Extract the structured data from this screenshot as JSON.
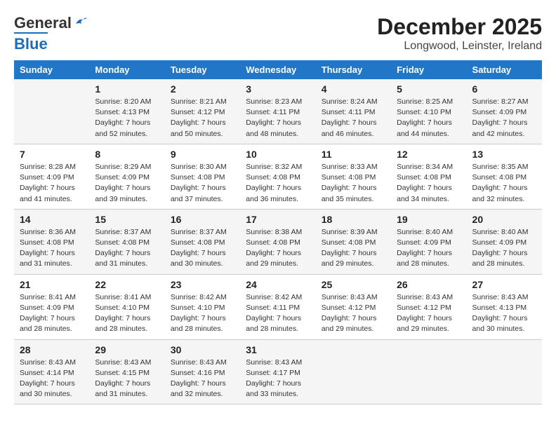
{
  "header": {
    "logo_general": "General",
    "logo_blue": "Blue",
    "title": "December 2025",
    "subtitle": "Longwood, Leinster, Ireland"
  },
  "days_of_week": [
    "Sunday",
    "Monday",
    "Tuesday",
    "Wednesday",
    "Thursday",
    "Friday",
    "Saturday"
  ],
  "weeks": [
    [
      {
        "day": "",
        "info": ""
      },
      {
        "day": "1",
        "info": "Sunrise: 8:20 AM\nSunset: 4:13 PM\nDaylight: 7 hours\nand 52 minutes."
      },
      {
        "day": "2",
        "info": "Sunrise: 8:21 AM\nSunset: 4:12 PM\nDaylight: 7 hours\nand 50 minutes."
      },
      {
        "day": "3",
        "info": "Sunrise: 8:23 AM\nSunset: 4:11 PM\nDaylight: 7 hours\nand 48 minutes."
      },
      {
        "day": "4",
        "info": "Sunrise: 8:24 AM\nSunset: 4:11 PM\nDaylight: 7 hours\nand 46 minutes."
      },
      {
        "day": "5",
        "info": "Sunrise: 8:25 AM\nSunset: 4:10 PM\nDaylight: 7 hours\nand 44 minutes."
      },
      {
        "day": "6",
        "info": "Sunrise: 8:27 AM\nSunset: 4:09 PM\nDaylight: 7 hours\nand 42 minutes."
      }
    ],
    [
      {
        "day": "7",
        "info": "Sunrise: 8:28 AM\nSunset: 4:09 PM\nDaylight: 7 hours\nand 41 minutes."
      },
      {
        "day": "8",
        "info": "Sunrise: 8:29 AM\nSunset: 4:09 PM\nDaylight: 7 hours\nand 39 minutes."
      },
      {
        "day": "9",
        "info": "Sunrise: 8:30 AM\nSunset: 4:08 PM\nDaylight: 7 hours\nand 37 minutes."
      },
      {
        "day": "10",
        "info": "Sunrise: 8:32 AM\nSunset: 4:08 PM\nDaylight: 7 hours\nand 36 minutes."
      },
      {
        "day": "11",
        "info": "Sunrise: 8:33 AM\nSunset: 4:08 PM\nDaylight: 7 hours\nand 35 minutes."
      },
      {
        "day": "12",
        "info": "Sunrise: 8:34 AM\nSunset: 4:08 PM\nDaylight: 7 hours\nand 34 minutes."
      },
      {
        "day": "13",
        "info": "Sunrise: 8:35 AM\nSunset: 4:08 PM\nDaylight: 7 hours\nand 32 minutes."
      }
    ],
    [
      {
        "day": "14",
        "info": "Sunrise: 8:36 AM\nSunset: 4:08 PM\nDaylight: 7 hours\nand 31 minutes."
      },
      {
        "day": "15",
        "info": "Sunrise: 8:37 AM\nSunset: 4:08 PM\nDaylight: 7 hours\nand 31 minutes."
      },
      {
        "day": "16",
        "info": "Sunrise: 8:37 AM\nSunset: 4:08 PM\nDaylight: 7 hours\nand 30 minutes."
      },
      {
        "day": "17",
        "info": "Sunrise: 8:38 AM\nSunset: 4:08 PM\nDaylight: 7 hours\nand 29 minutes."
      },
      {
        "day": "18",
        "info": "Sunrise: 8:39 AM\nSunset: 4:08 PM\nDaylight: 7 hours\nand 29 minutes."
      },
      {
        "day": "19",
        "info": "Sunrise: 8:40 AM\nSunset: 4:09 PM\nDaylight: 7 hours\nand 28 minutes."
      },
      {
        "day": "20",
        "info": "Sunrise: 8:40 AM\nSunset: 4:09 PM\nDaylight: 7 hours\nand 28 minutes."
      }
    ],
    [
      {
        "day": "21",
        "info": "Sunrise: 8:41 AM\nSunset: 4:09 PM\nDaylight: 7 hours\nand 28 minutes."
      },
      {
        "day": "22",
        "info": "Sunrise: 8:41 AM\nSunset: 4:10 PM\nDaylight: 7 hours\nand 28 minutes."
      },
      {
        "day": "23",
        "info": "Sunrise: 8:42 AM\nSunset: 4:10 PM\nDaylight: 7 hours\nand 28 minutes."
      },
      {
        "day": "24",
        "info": "Sunrise: 8:42 AM\nSunset: 4:11 PM\nDaylight: 7 hours\nand 28 minutes."
      },
      {
        "day": "25",
        "info": "Sunrise: 8:43 AM\nSunset: 4:12 PM\nDaylight: 7 hours\nand 29 minutes."
      },
      {
        "day": "26",
        "info": "Sunrise: 8:43 AM\nSunset: 4:12 PM\nDaylight: 7 hours\nand 29 minutes."
      },
      {
        "day": "27",
        "info": "Sunrise: 8:43 AM\nSunset: 4:13 PM\nDaylight: 7 hours\nand 30 minutes."
      }
    ],
    [
      {
        "day": "28",
        "info": "Sunrise: 8:43 AM\nSunset: 4:14 PM\nDaylight: 7 hours\nand 30 minutes."
      },
      {
        "day": "29",
        "info": "Sunrise: 8:43 AM\nSunset: 4:15 PM\nDaylight: 7 hours\nand 31 minutes."
      },
      {
        "day": "30",
        "info": "Sunrise: 8:43 AM\nSunset: 4:16 PM\nDaylight: 7 hours\nand 32 minutes."
      },
      {
        "day": "31",
        "info": "Sunrise: 8:43 AM\nSunset: 4:17 PM\nDaylight: 7 hours\nand 33 minutes."
      },
      {
        "day": "",
        "info": ""
      },
      {
        "day": "",
        "info": ""
      },
      {
        "day": "",
        "info": ""
      }
    ]
  ]
}
